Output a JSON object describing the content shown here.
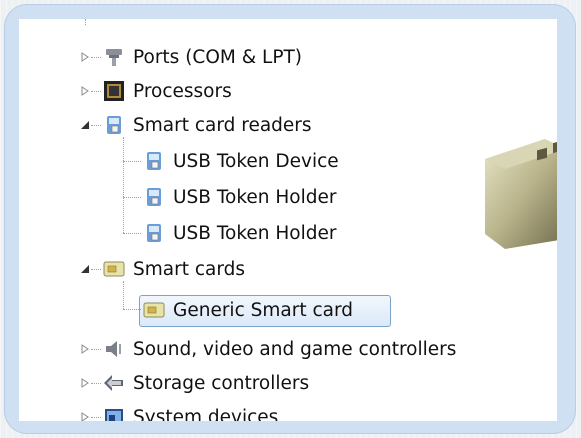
{
  "tree": {
    "items": [
      {
        "label": "Ports (COM & LPT)",
        "icon": "port-icon",
        "expander": "collapsed"
      },
      {
        "label": "Processors",
        "icon": "processor-icon",
        "expander": "collapsed"
      },
      {
        "label": "Smart card readers",
        "icon": "smart-card-reader-icon",
        "expander": "expanded"
      },
      {
        "label": "USB Token Device",
        "icon": "smart-card-reader-icon"
      },
      {
        "label": "USB Token Holder",
        "icon": "smart-card-reader-icon"
      },
      {
        "label": "USB Token Holder",
        "icon": "smart-card-reader-icon"
      },
      {
        "label": "Smart cards",
        "icon": "smart-card-icon",
        "expander": "expanded"
      },
      {
        "label": "Generic Smart card",
        "icon": "smart-card-icon",
        "selected": true
      },
      {
        "label": "Sound, video and game controllers",
        "icon": "speaker-icon",
        "expander": "collapsed"
      },
      {
        "label": "Storage controllers",
        "icon": "storage-controller-icon",
        "expander": "collapsed"
      },
      {
        "label": "System devices",
        "icon": "system-devices-icon",
        "expander": "collapsed"
      }
    ]
  },
  "colors": {
    "frame": "#cfe0f3",
    "selection_border": "#7da2ce",
    "selection_fill": "#dbe9f8"
  }
}
